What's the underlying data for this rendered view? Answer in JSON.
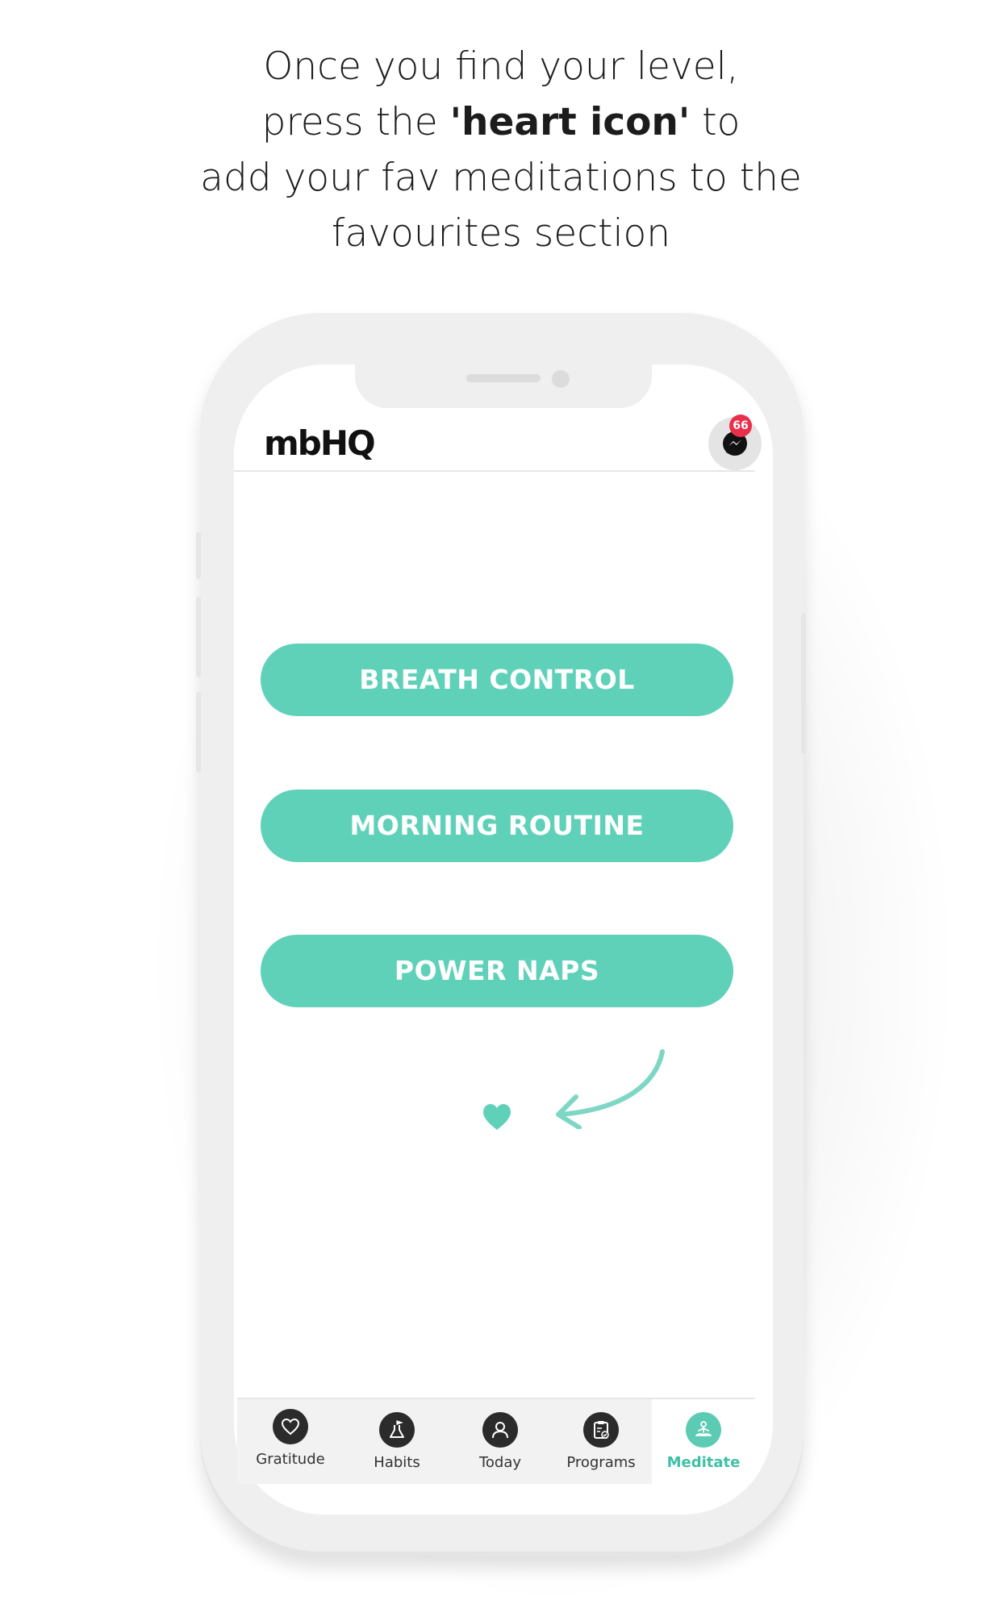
{
  "caption": {
    "line1": "Once you find your level,",
    "line2_pre": "press the ",
    "line2_bold": "'heart icon'",
    "line2_post": " to",
    "line3": "add your fav meditations to the",
    "line4": "favourites section"
  },
  "app": {
    "logo": "mbHQ",
    "messenger_badge": "66"
  },
  "meditations": [
    {
      "label": "BREATH CONTROL"
    },
    {
      "label": "MORNING ROUTINE"
    },
    {
      "label": "POWER NAPS"
    }
  ],
  "tabbar": {
    "items": [
      {
        "label": "Gratitude",
        "icon": "heart-icon"
      },
      {
        "label": "Habits",
        "icon": "flask-flag-icon"
      },
      {
        "label": "Today",
        "icon": "person-icon"
      },
      {
        "label": "Programs",
        "icon": "clipboard-icon"
      },
      {
        "label": "Meditate",
        "icon": "meditation-icon"
      }
    ],
    "active": "Meditate"
  },
  "colors": {
    "accent": "#60d1b9",
    "active_tab": "#3fbfa5",
    "badge": "#e8304a"
  }
}
